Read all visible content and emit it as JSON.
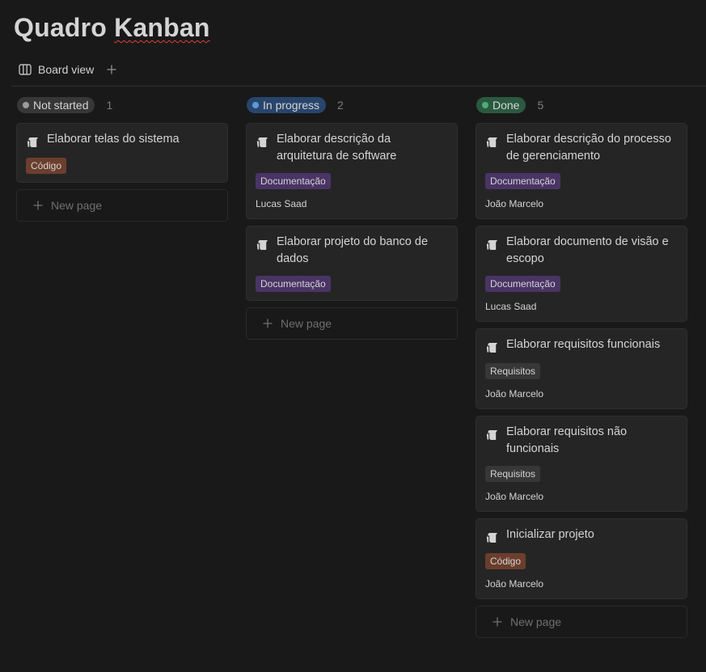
{
  "page": {
    "title_part1": "Quadro",
    "title_part2": "Kanban"
  },
  "views": {
    "active_label": "Board view",
    "add_icon": "plus-icon",
    "board_icon": "board-view-icon"
  },
  "new_page_label": "New page",
  "colors": {
    "background": "#191919",
    "card": "#252525",
    "tag_documentacao_bg": "#4a3465",
    "tag_codigo_bg": "#6b3e2d",
    "tag_requisitos_bg": "#373737"
  },
  "columns": [
    {
      "status": "Not started",
      "count": "1",
      "pill_bg": "#373737",
      "dot": "#9b9b9b",
      "cards": [
        {
          "title": "Elaborar telas do sistema",
          "tag": "Código",
          "tag_bg": "#6b3e2d",
          "assignee": ""
        }
      ]
    },
    {
      "status": "In progress",
      "count": "2",
      "pill_bg": "#28456c",
      "dot": "#5b9bd5",
      "cards": [
        {
          "title": "Elaborar descrição da arquitetura de software",
          "tag": "Documentação",
          "tag_bg": "#4a3465",
          "assignee": "Lucas Saad"
        },
        {
          "title": "Elaborar projeto do banco de dados",
          "tag": "Documentação",
          "tag_bg": "#4a3465",
          "assignee": ""
        }
      ]
    },
    {
      "status": "Done",
      "count": "5",
      "pill_bg": "#2b593f",
      "dot": "#4dab7a",
      "cards": [
        {
          "title": "Elaborar descrição do processo de gerenciamento",
          "tag": "Documentação",
          "tag_bg": "#4a3465",
          "assignee": "João Marcelo"
        },
        {
          "title": "Elaborar documento de visão e escopo",
          "tag": "Documentação",
          "tag_bg": "#4a3465",
          "assignee": "Lucas Saad"
        },
        {
          "title": "Elaborar requisitos funcionais",
          "tag": "Requisitos",
          "tag_bg": "#373737",
          "assignee": "João Marcelo"
        },
        {
          "title": "Elaborar requisitos não funcionais",
          "tag": "Requisitos",
          "tag_bg": "#373737",
          "assignee": "João Marcelo"
        },
        {
          "title": "Inicializar projeto",
          "tag": "Código",
          "tag_bg": "#6b3e2d",
          "assignee": "João Marcelo"
        }
      ]
    }
  ]
}
